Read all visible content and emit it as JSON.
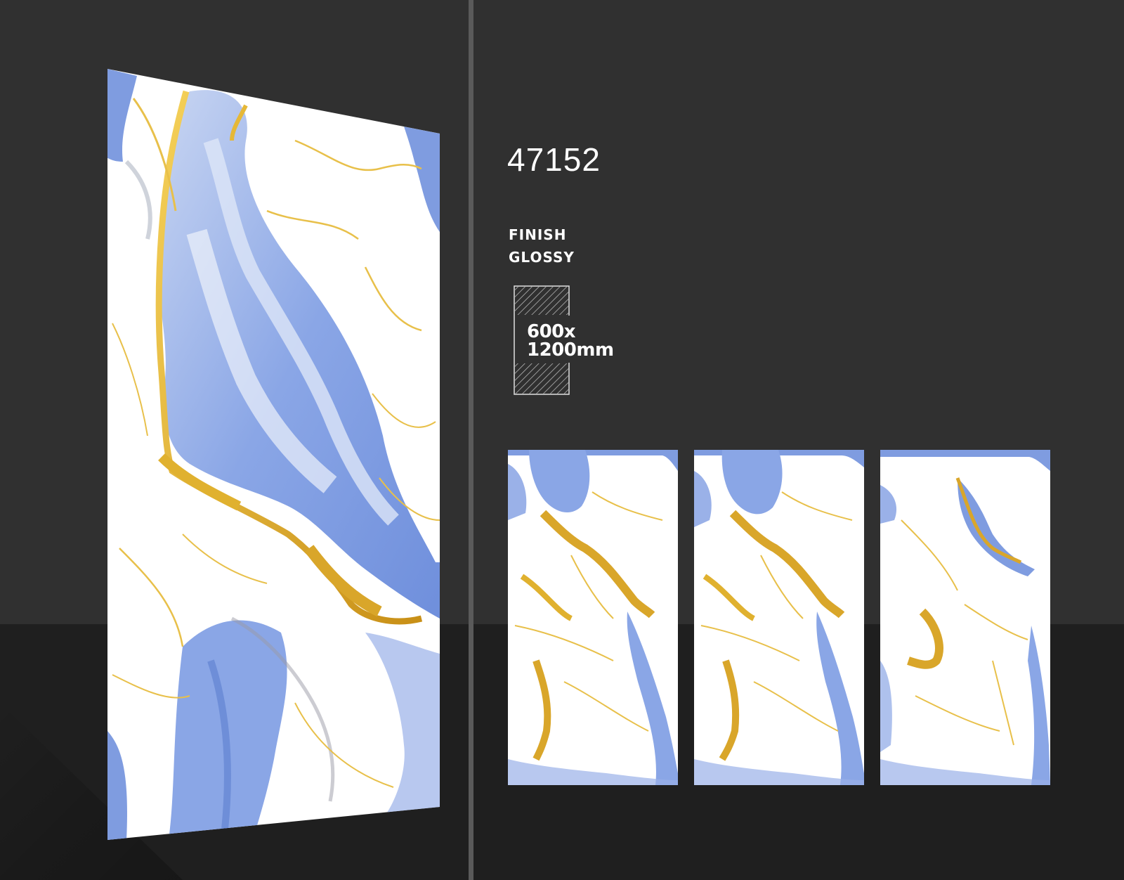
{
  "product": {
    "code": "47152",
    "finish_label": "FINISH",
    "finish_value": "GLOSSY",
    "size_line1": "600x",
    "size_line2": "1200mm"
  },
  "colors": {
    "background": "#303030",
    "floor": "#1f1f1f",
    "marble_white": "#ffffff",
    "marble_blue": "#7d9be0",
    "marble_gold": "#e0b12f"
  },
  "icons": {
    "size": "tile-size-icon"
  }
}
